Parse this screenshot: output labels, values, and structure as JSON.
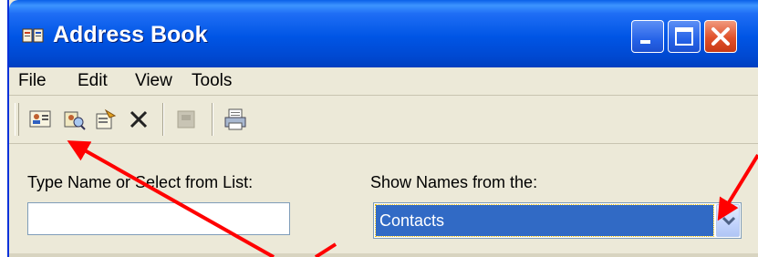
{
  "window": {
    "title": "Address Book",
    "icon": "address-book-icon",
    "controls": [
      "minimize-icon",
      "maximize-icon",
      "close-icon"
    ]
  },
  "menu": {
    "items": [
      "File",
      "Edit",
      "View",
      "Tools"
    ]
  },
  "toolbar": {
    "buttons": [
      {
        "icon": "new-contact-icon",
        "enabled": true
      },
      {
        "icon": "find-people-icon",
        "enabled": true
      },
      {
        "icon": "properties-icon",
        "enabled": true
      },
      {
        "icon": "delete-icon",
        "enabled": true
      },
      {
        "icon": "action-icon",
        "enabled": false
      },
      {
        "icon": "print-icon",
        "enabled": true
      }
    ]
  },
  "form": {
    "type_name_label": "Type Name or Select from List:",
    "type_name_value": "",
    "show_names_label": "Show Names from the:",
    "show_names_value": "Contacts"
  },
  "annotation": {
    "arrow_color": "#ff0000"
  }
}
